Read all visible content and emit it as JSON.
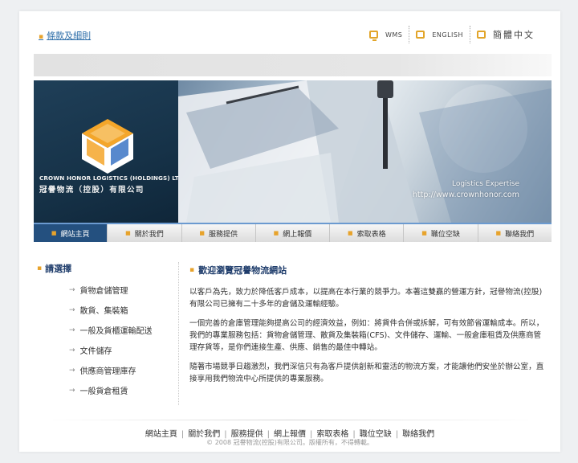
{
  "top": {
    "terms_link": "條款及細則",
    "languages": [
      {
        "label": "WMS",
        "icon": "monitor-icon"
      },
      {
        "label": "ENGLISH",
        "icon": "flag-icon"
      },
      {
        "label": "簡體中文",
        "icon": "flag-icon"
      }
    ]
  },
  "banner": {
    "company_en": "CROWN HONOR LOGISTICS (HOLDINGS) LTD.",
    "company_cn": "冠譽物流（控股）有限公司",
    "slogan": "Logistics Expertise",
    "url": "http://www.crownhonor.com"
  },
  "nav": {
    "items": [
      "網站主頁",
      "關於我們",
      "服務提供",
      "網上報價",
      "索取表格",
      "職位空缺",
      "聯絡我們"
    ],
    "active_index": 0
  },
  "sidebar": {
    "title": "請選擇",
    "items": [
      "貨物倉儲管理",
      "散貨、集裝箱",
      "一般及貨櫃運輸配送",
      "文件儲存",
      "供應商管理庫存",
      "一般貨倉租賃"
    ]
  },
  "main": {
    "title": "歡迎瀏覽冠譽物流網站",
    "paragraphs": [
      "以客戶為先，致力於降低客戶成本，以提高在本行業的競爭力。本著這雙贏的營運方針，冠譽物流(控股)有限公司已擁有二十多年的倉儲及運輸經驗。",
      "一個完善的倉庫管理能夠提高公司的經濟效益，例如：將貨件合併或拆解，可有效節省運輸成本。所以，我們的專業服務包括：貨物倉儲管理、散貨及集裝箱(CFS)、文件儲存、運輸、一般倉庫租賃及供應商管理存貨等，是你們連接生產、供應、銷售的最佳中轉站。",
      "隨著市場競爭日趨激烈，我們深信只有為客戶提供創新和靈活的物流方案，才能讓他們安坐於辦公室，直接享用我們物流中心所提供的專業服務。"
    ]
  },
  "footer": {
    "links": [
      "網站主頁",
      "關於我們",
      "服務提供",
      "網上報價",
      "索取表格",
      "職位空缺",
      "聯絡我們"
    ],
    "copyright": "© 2008 冠譽物流(控股)有限公司。版權所有，不得轉載。"
  },
  "colors": {
    "accent": "#e7a32c",
    "nav_active": "#24507f",
    "heading": "#1e3c6b",
    "nav_border": "#6b9ad0"
  }
}
